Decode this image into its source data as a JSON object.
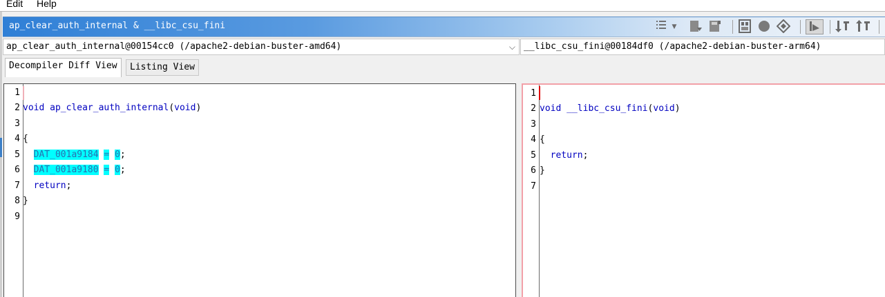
{
  "menu": {
    "edit": "Edit",
    "help": "Help"
  },
  "window": {
    "title": "ap_clear_auth_internal & __libc_csu_fini"
  },
  "toolbar": {
    "icons": [
      "list-icon",
      "dropdown-arrow-icon",
      "export-icon",
      "save-icon",
      "function-graph-icon",
      "circle-icon",
      "diamond-icon",
      "cursor-select-icon",
      "sort-down-icon",
      "sort-up-icon"
    ]
  },
  "left_function": {
    "value": "ap_clear_auth_internal@00154cc0 (/apache2-debian-buster-amd64)"
  },
  "right_function": {
    "value": "__libc_csu_fini@00184df0 (/apache2-debian-buster-arm64)"
  },
  "tabs": {
    "decompiler": "Decompiler Diff View",
    "listing": "Listing View"
  },
  "left_code": {
    "line_numbers": [
      "1",
      "2",
      "3",
      "4",
      "5",
      "6",
      "7",
      "8",
      "9"
    ],
    "void_kw": "void",
    "func_name": "ap_clear_auth_internal",
    "params_open": "(",
    "params_kw": "void",
    "params_close": ")",
    "brace_open": "{",
    "dat1": "DAT_001a9184",
    "dat2": "DAT_001a9180",
    "assign": "=",
    "zero": "0",
    "semi": ";",
    "return_kw": "return",
    "brace_close": "}"
  },
  "right_code": {
    "line_numbers": [
      "1",
      "2",
      "3",
      "4",
      "5",
      "6",
      "7"
    ],
    "void_kw": "void",
    "func_name": "__libc_csu_fini",
    "params_open": "(",
    "params_kw": "void",
    "params_close": ")",
    "brace_open": "{",
    "return_kw": "return",
    "semi": ";",
    "brace_close": "}"
  },
  "colors": {
    "highlight": "#00ffff",
    "keyword": "#0000c0",
    "title_start": "#2f7fd6",
    "right_border": "#f2a0a8"
  }
}
